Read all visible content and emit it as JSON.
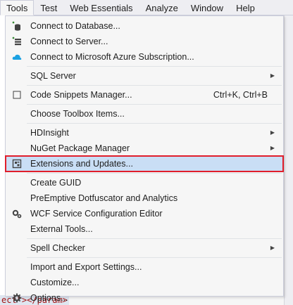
{
  "menubar": {
    "items": [
      {
        "label": "Tools",
        "active": true
      },
      {
        "label": "Test"
      },
      {
        "label": "Web Essentials"
      },
      {
        "label": "Analyze"
      },
      {
        "label": "Window"
      },
      {
        "label": "Help"
      }
    ]
  },
  "menu": {
    "connect_database": "Connect to Database...",
    "connect_server": "Connect to Server...",
    "connect_azure": "Connect to Microsoft Azure Subscription...",
    "sql_server": "SQL Server",
    "code_snippets": "Code Snippets Manager...",
    "code_snippets_shortcut": "Ctrl+K, Ctrl+B",
    "choose_toolbox": "Choose Toolbox Items...",
    "hdinsight": "HDInsight",
    "nuget": "NuGet Package Manager",
    "extensions": "Extensions and Updates...",
    "create_guid": "Create GUID",
    "preemptive": "PreEmptive Dotfuscator and Analytics",
    "wcf_editor": "WCF Service Configuration Editor",
    "external_tools": "External Tools...",
    "spell_checker": "Spell Checker",
    "import_export": "Import and Export Settings...",
    "customize": "Customize...",
    "options": "Options..."
  },
  "background": {
    "code_fragment": "ect\"></param>"
  },
  "colors": {
    "highlight_bg": "#c9def5",
    "highlight_border": "#e01e2b",
    "menu_bg": "#f6f6f6"
  }
}
